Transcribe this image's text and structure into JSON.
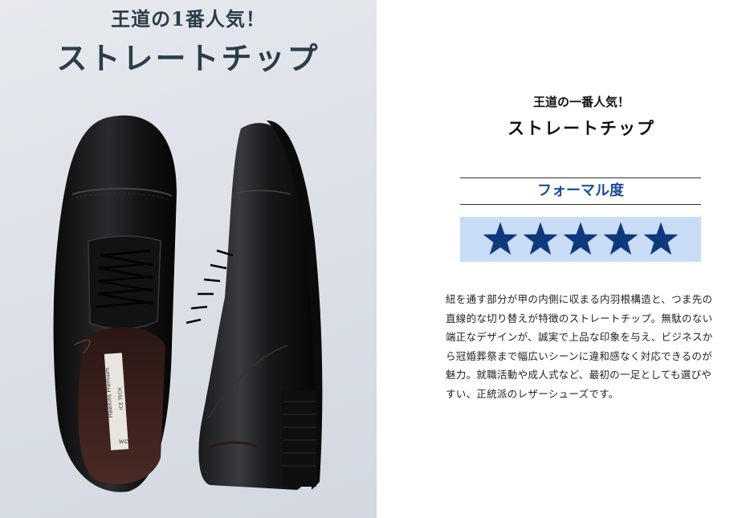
{
  "photo": {
    "kicker": "王道の1番人気！",
    "title": "ストレートチップ",
    "insole_brand": "Hawkins Premium",
    "insole_tech": "ICE TECH",
    "insole_size": "WIDE"
  },
  "info": {
    "kicker": "王道の一番人気！",
    "title": "ストレートチップ",
    "formality_label": "フォーマル度",
    "formality_rating": 5,
    "formality_max": 5,
    "star_color": "#0d3a7c",
    "star_bg_color": "#c9dcf6",
    "heading_color": "#1b4d9a",
    "description": "紐を通す部分が甲の内側に収まる内羽根構造と、つま先の直線的な切り替えが特徴のストレートチップ。無駄のない端正なデザインが、誠実で上品な印象を与え、ビジネスから冠婚葬祭まで幅広いシーンに違和感なく対応できるのが魅力。就職活動や成人式など、最初の一足としても選びやすい、正統派のレザーシューズです。"
  }
}
